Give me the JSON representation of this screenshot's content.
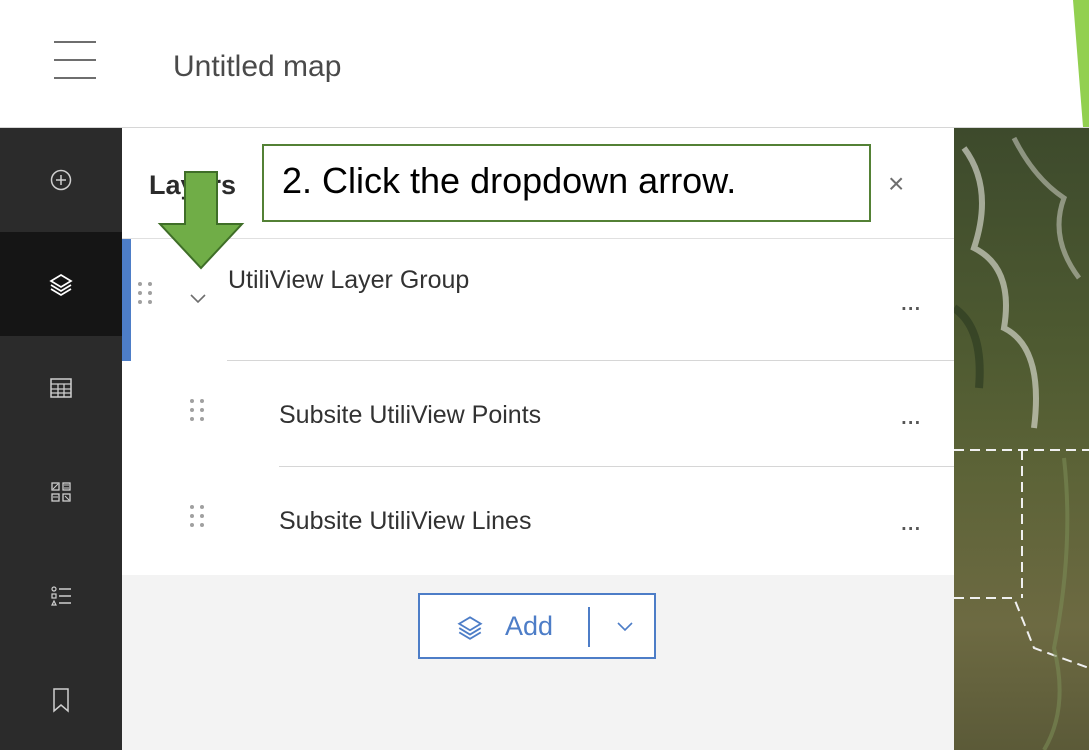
{
  "header": {
    "map_title": "Untitled map"
  },
  "panel": {
    "title": "Layers",
    "close_label": "×",
    "group": {
      "name": "UtiliView Layer Group"
    },
    "layers": [
      {
        "name": "Subsite UtiliView Points"
      },
      {
        "name": "Subsite UtiliView Lines"
      }
    ],
    "more_label": "...",
    "add_label": "Add"
  },
  "annotation": {
    "text": "2. Click the dropdown arrow."
  },
  "icons": [
    "menu-icon",
    "add-circle-icon",
    "layers-icon",
    "table-icon",
    "widgets-icon",
    "legend-icon",
    "bookmark-icon",
    "chevron-down-icon",
    "drag-handle-icon",
    "more-icon",
    "close-icon"
  ],
  "colors": {
    "accent": "#4d7dc7",
    "annotation_green": "#70ad47",
    "action_bar": "#2b2b2b"
  }
}
